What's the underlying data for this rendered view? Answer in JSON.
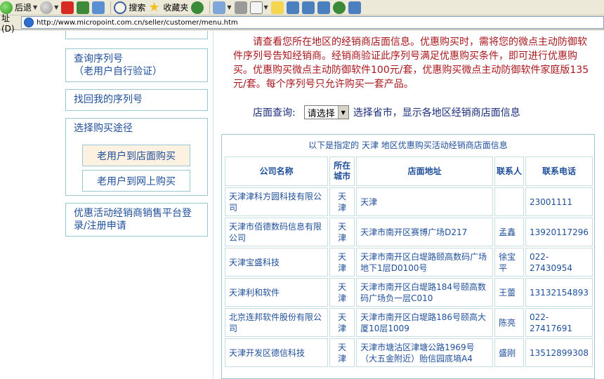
{
  "toolbar": {
    "back_label": "后退",
    "search_label": "搜索",
    "favorites_label": "收藏夹"
  },
  "address": {
    "label": "址(D)",
    "url": "http://www.micropoint.com.cn/seller/customer/menu.htm"
  },
  "sidebar": {
    "items": [
      {
        "label": "查询序列号\n（老用户自行验证）"
      },
      {
        "label": "找回我的序列号"
      },
      {
        "label": "选择购买途径"
      },
      {
        "label": "老用户到店面购买"
      },
      {
        "label": "老用户到网上购买"
      },
      {
        "label": "优惠活动经销商销售平台登录/注册申请"
      }
    ]
  },
  "intro_text": "请查看您所在地区的经销商店面信息。优惠购买时，需将您的微点主动防御软件序列号告知经销商。经销商验证此序列号满足优惠购买条件，即可进行优惠购买。优惠购买微点主动防御软件100元/套，优惠购买微点主动防御软件家庭版135元/套。每个序列号只允许购买一套产品。",
  "query": {
    "label": "店面查询:",
    "select_value": "请选择",
    "hint": "选择省市，显示各地区经销商店面信息"
  },
  "table": {
    "caption": "以下是指定的 天津 地区优惠购买活动经销商店面信息",
    "headers": [
      "公司名称",
      "所在城市",
      "店面地址",
      "联系人",
      "联系电话"
    ],
    "rows": [
      [
        "天津津科方圆科技有限公司",
        "天津",
        "天津",
        "",
        "23001111"
      ],
      [
        "天津市佰德数码信息有限公司",
        "天津",
        "天津市南开区赛博广场D217",
        "孟鑫",
        "13920117296"
      ],
      [
        "天津宝盛科技",
        "天津",
        "天津市南开区白堤路颐高数码广场地下1层D0100号",
        "徐宝平",
        "022-27430954"
      ],
      [
        "天津利和软件",
        "天津",
        "天津市南开区白堤路184号颐高数码广场负一层C010",
        "王蕾",
        "13132154893"
      ],
      [
        "北京连邦软件股份有限公司",
        "天津",
        "天津市南开区白堤路186号颐高大厦10层1009",
        "陈亮",
        "022-27417691"
      ],
      [
        "天津开发区德信科技",
        "天津",
        "天津市塘沽区津塘公路1969号（大五金附近）贻信园底墒A4",
        "盛刚",
        "13512899308"
      ]
    ]
  }
}
